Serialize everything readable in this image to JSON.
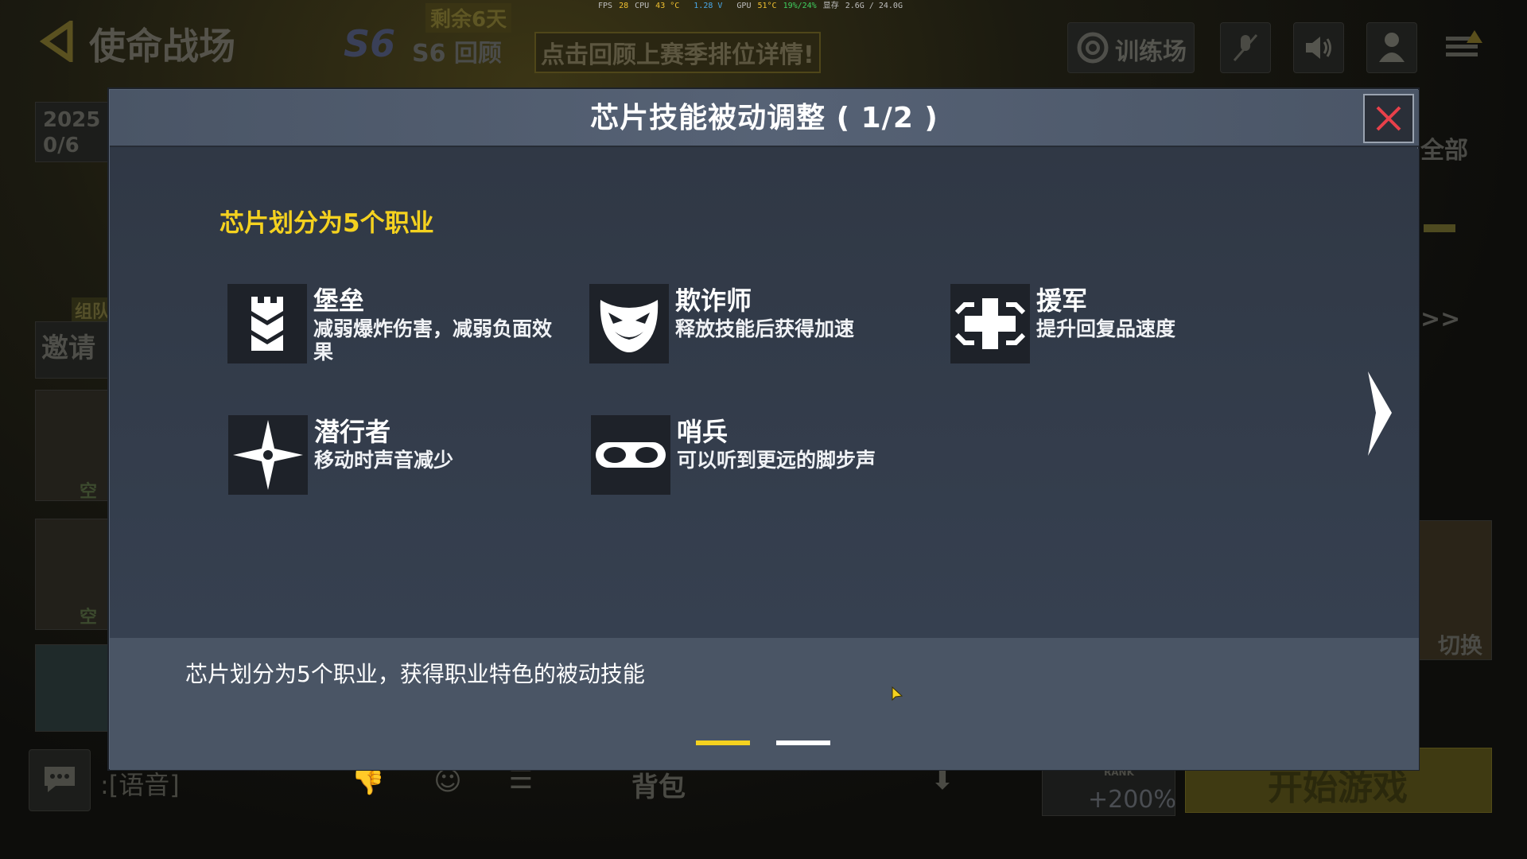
{
  "hud": {
    "fps_label": "FPS",
    "fps_value": "28",
    "cpu_label": "CPU",
    "cpu_temp": "43 °C",
    "voltage": "1.28 V",
    "gpu_label": "GPU",
    "gpu_temp": "51°C",
    "gpu_usage": "19%/24%",
    "vram_label": "显存",
    "vram_value": "2.6G / 24.0G"
  },
  "background": {
    "mode_title": "使命战场",
    "days_left": "剩余6天",
    "season_badge": "S6",
    "season_review": "S6 回顾",
    "season_banner": "点击回顾上赛季排位详情!",
    "training": "训练场",
    "date_year": "2025",
    "date_count": "0/6",
    "team_label": "组队",
    "invite_label": "邀请",
    "empty_1": "空",
    "empty_2": "空",
    "voice_label": ":[语音]",
    "backpack": "背包",
    "bonus": "+200%",
    "rank_label": "RANK",
    "start_game": "开始游戏",
    "switch": "切换",
    "all_label": "全部",
    "double_arrow": ">>"
  },
  "modal": {
    "title": "芯片技能被动调整 ( 1/2 )",
    "section_title": "芯片划分为5个职业",
    "classes": [
      {
        "name": "堡垒",
        "desc": "减弱爆炸伤害，减弱负面效果",
        "icon": "fortress-tower-icon"
      },
      {
        "name": "欺诈师",
        "desc": "释放技能后获得加速",
        "icon": "trickster-mask-icon"
      },
      {
        "name": "援军",
        "desc": "提升回复品速度",
        "icon": "medic-cross-icon"
      },
      {
        "name": "潜行者",
        "desc": "移动时声音减少",
        "icon": "shuriken-star-icon"
      },
      {
        "name": "哨兵",
        "desc": "可以听到更远的脚步声",
        "icon": "goggles-icon"
      }
    ],
    "footer_text": "芯片划分为5个职业，获得职业特色的被动技能",
    "pagination": {
      "current": 1,
      "total": 2
    },
    "colors": {
      "active_dot": "#f5d21f",
      "inactive_dot": "#ffffff",
      "section_title": "#f5d21f",
      "close_x": "#e8404a"
    }
  }
}
